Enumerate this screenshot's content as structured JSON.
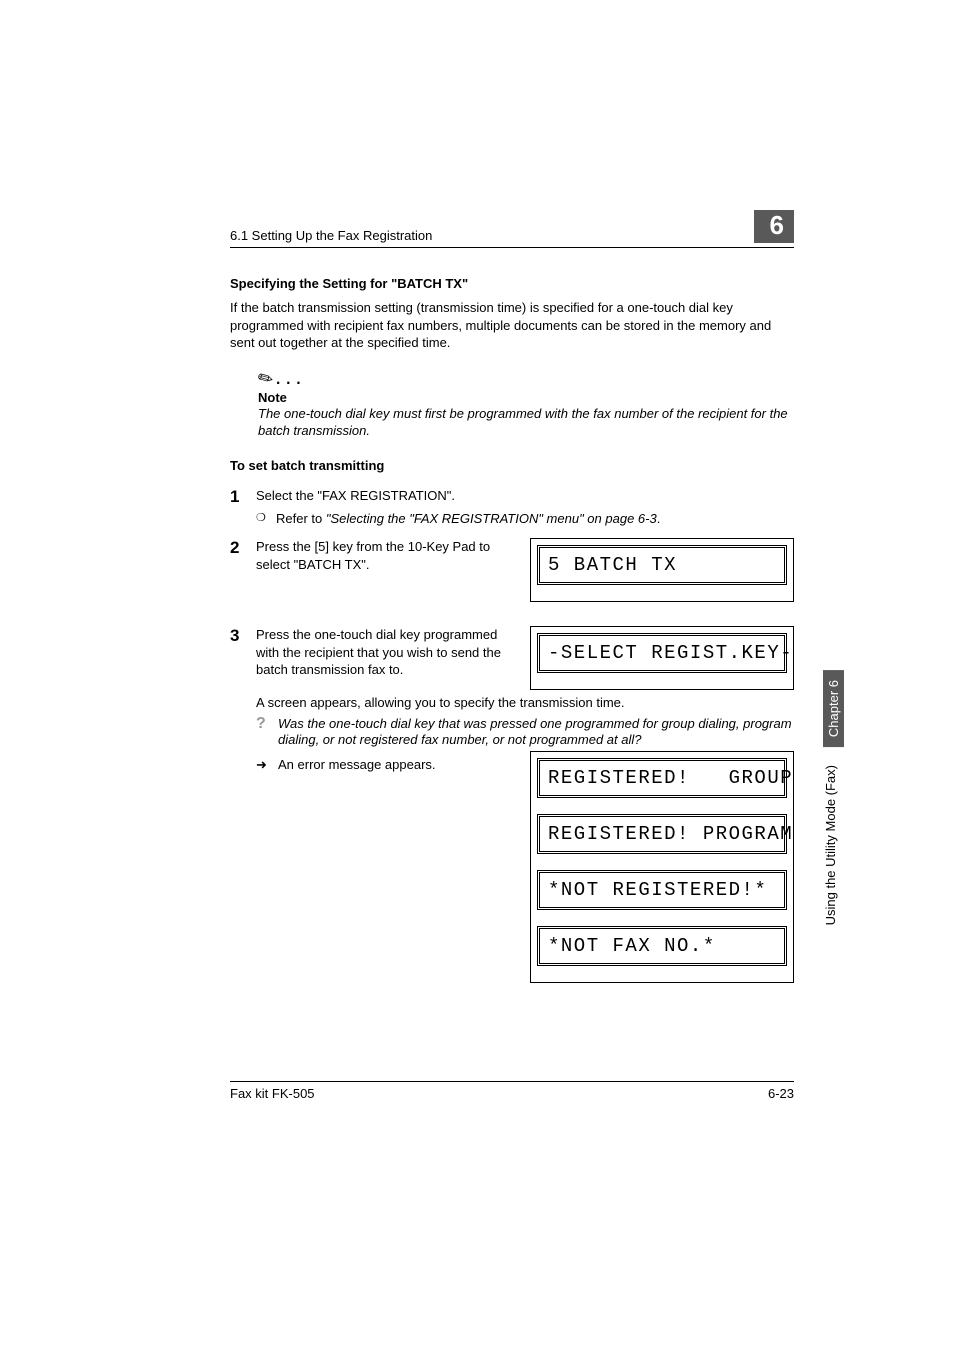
{
  "header": {
    "section_path": "6.1 Setting Up the Fax Registration",
    "chapter_number": "6"
  },
  "h1": "Specifying the Setting for \"BATCH TX\"",
  "intro": "If the batch transmission setting (transmission time) is specified for a one-touch dial key programmed with recipient fax numbers, multiple documents can be stored in the memory and sent out together at the specified time.",
  "note": {
    "label": "Note",
    "text": "The one-touch dial key must first be programmed with the fax number of the recipient for the batch transmission."
  },
  "h2": "To set batch transmitting",
  "steps": {
    "s1": {
      "num": "1",
      "text": "Select the \"FAX REGISTRATION\".",
      "sub_mark": "❍",
      "sub_prefix": "Refer to ",
      "sub_italic": "\"Selecting the \"FAX REGISTRATION\" menu\" on page 6-3",
      "sub_suffix": "."
    },
    "s2": {
      "num": "2",
      "text": "Press the [5] key from the 10-Key Pad to select \"BATCH TX\".",
      "lcd": "5 BATCH TX"
    },
    "s3": {
      "num": "3",
      "text": "Press the one-touch dial key programmed with the recipient that you wish to send the batch transmission fax to.",
      "lcd": "-SELECT REGIST.KEY-",
      "after": "A screen appears, allowing you to specify the transmission time.",
      "q_mark": "?",
      "q_text": "Was the one-touch dial key that was pressed one programmed for group dialing, program dialing, or not registered fax number, or not programmed at all?",
      "arrow": "➜",
      "arrow_text": "An error message appears.",
      "errors": [
        "REGISTERED!   GROUP",
        "REGISTERED! PROGRAM",
        "*NOT REGISTERED!*",
        "*NOT FAX NO.*"
      ]
    }
  },
  "side": {
    "chapter": "Chapter 6",
    "title": "Using the Utility Mode (Fax)"
  },
  "footer": {
    "left": "Fax kit FK-505",
    "right": "6-23"
  }
}
